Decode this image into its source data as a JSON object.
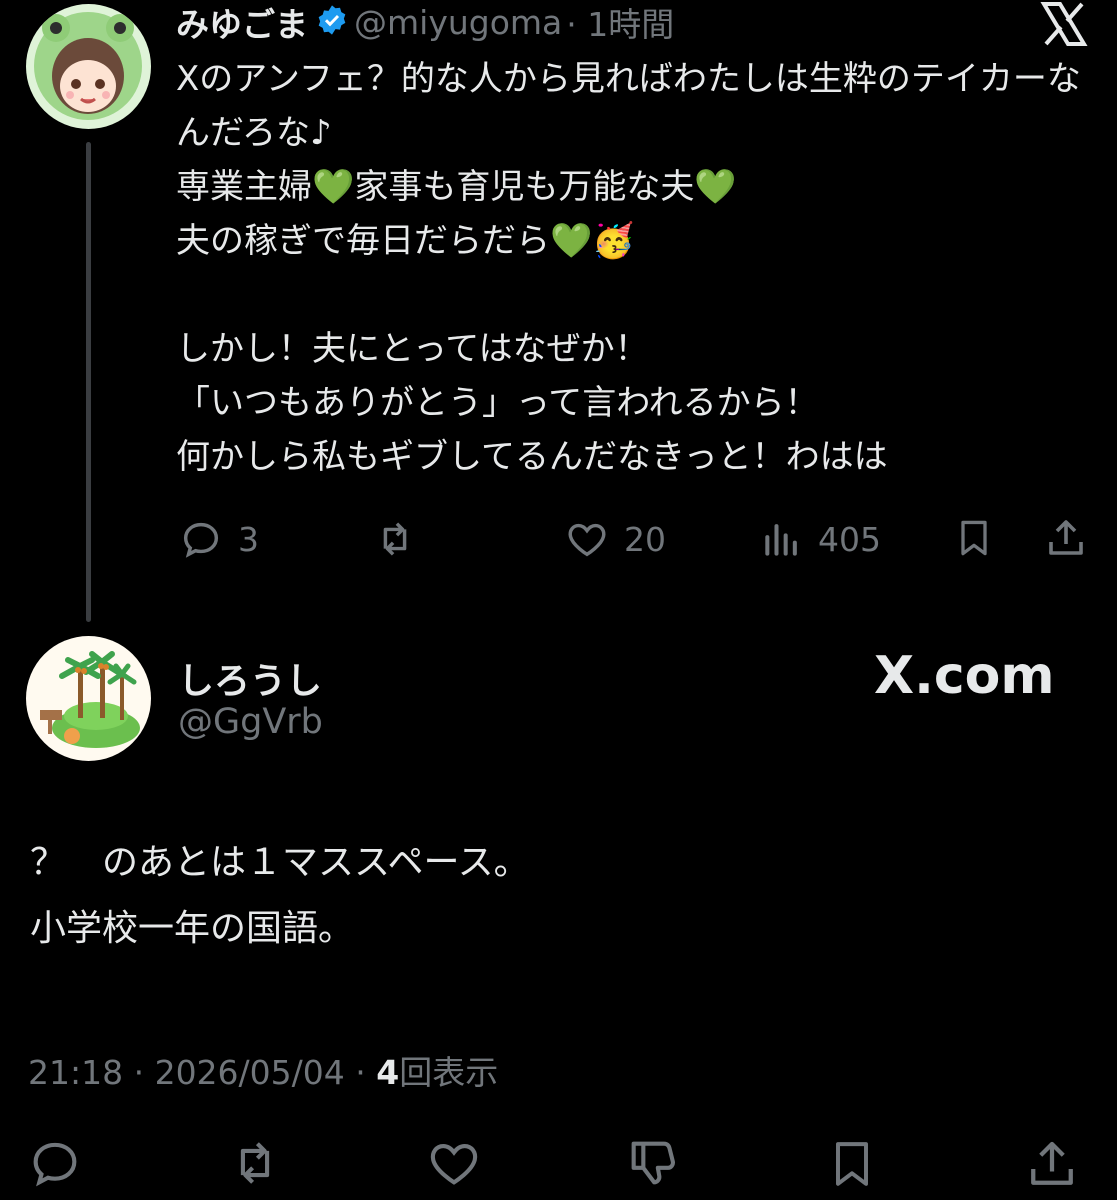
{
  "quoted_tweet": {
    "display_name": "みゆごま",
    "handle": "@miyugoma",
    "time": "· 1時間",
    "text": "Xのアンフェ？的な人から見ればわたしは生粋のテイカーなんだろな♪\n専業主婦💚家事も育児も万能な夫💚\n夫の稼ぎで毎日だらだら💚🥳\n\nしかし！夫にとってはなぜか！\n「いつもありがとう」って言われるから！\n何かしら私もギブしてるんだなきっと！わはは",
    "stats": {
      "replies": "3",
      "likes": "20",
      "views": "405"
    },
    "icons": [
      "reply-icon",
      "repost-icon",
      "like-icon",
      "views-icon",
      "bookmark-icon",
      "share-icon",
      "x-logo-icon",
      "verified-badge-icon"
    ]
  },
  "reply_tweet": {
    "display_name": "しろうし",
    "handle": "@GgVrb",
    "brand": "X.com",
    "text": "？　のあとは１マススペース。\n小学校一年の国語。",
    "timestamp": "21:18 · 2026/05/04 · ",
    "view_count": "4",
    "view_label": "回表示"
  },
  "bottom_actions": [
    "reply-icon",
    "repost-icon",
    "like-icon",
    "dislike-icon",
    "bookmark-icon",
    "share-icon"
  ],
  "colors": {
    "background": "#000000",
    "text": "#e7e9ea",
    "muted": "#71767b",
    "verified": "#1d9bf0",
    "thread_line": "#3a3d41"
  }
}
